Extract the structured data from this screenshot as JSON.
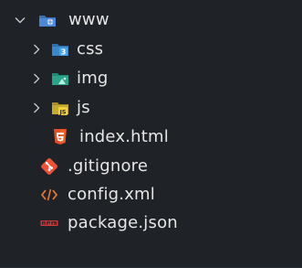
{
  "tree": {
    "root": {
      "label": "www",
      "expanded": true
    },
    "folders": [
      {
        "label": "css",
        "expanded": false
      },
      {
        "label": "img",
        "expanded": false
      },
      {
        "label": "js",
        "expanded": false
      }
    ],
    "files": [
      {
        "label": "index.html",
        "icon": "html5-icon"
      },
      {
        "label": ".gitignore",
        "icon": "git-icon"
      },
      {
        "label": "config.xml",
        "icon": "xml-icon"
      },
      {
        "label": "package.json",
        "icon": "npm-icon"
      }
    ]
  },
  "colors": {
    "background": "#1f2227",
    "text": "#e6e6e6",
    "chevron": "#c7c7c7",
    "html": "#e44d26",
    "git": "#f05133",
    "xml": "#e37933",
    "npm": "#cb3837",
    "folder_www": "#4d88d6",
    "folder_css": "#3b87cc",
    "folder_img": "#2aa389",
    "folder_js": "#c4aa31"
  }
}
